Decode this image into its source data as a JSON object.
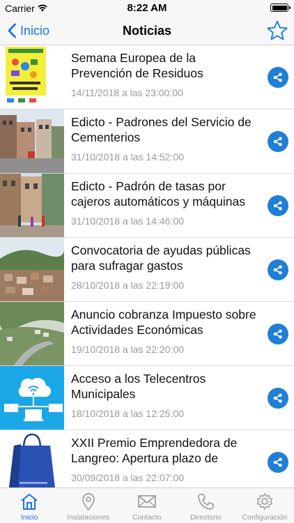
{
  "status_bar": {
    "carrier": "Carrier",
    "time": "8:22 AM"
  },
  "nav": {
    "back_label": "Inicio",
    "title": "Noticias"
  },
  "news": [
    {
      "title": "Semana Europea de la Prevención de Residuos",
      "date": "14/11/2018 a las 23:00:00",
      "thumb": "poster"
    },
    {
      "title": "Edicto - Padrones del Servicio de Cementerios",
      "date": "31/10/2018 a las 14:52:00",
      "thumb": "street"
    },
    {
      "title": "Edicto - Padrón de tasas por cajeros automáticos y máquinas",
      "date": "31/10/2018 a las 14:46:00",
      "thumb": "street2"
    },
    {
      "title": "Convocatoria de ayudas públicas para sufragar gastos",
      "date": "28/10/2018 a las 22:19:00",
      "thumb": "town"
    },
    {
      "title": "Anuncio cobranza Impuesto sobre Actividades Económicas",
      "date": "19/10/2018 a las 22:20:00",
      "thumb": "valley"
    },
    {
      "title": "Acceso a los Telecentros Municipales",
      "date": "18/10/2018 a las 12:25:00",
      "thumb": "network"
    },
    {
      "title": "XXII Premio Emprendedora de Langreo: Apertura plazo de",
      "date": "30/09/2018 a las 22:07:00",
      "thumb": "bag"
    }
  ],
  "tabs": [
    {
      "label": "Inicio",
      "icon": "home-icon",
      "active": true
    },
    {
      "label": "Instalaciones",
      "icon": "location-pin-icon",
      "active": false
    },
    {
      "label": "Contacto",
      "icon": "envelope-icon",
      "active": false
    },
    {
      "label": "Directorio",
      "icon": "phone-icon",
      "active": false
    },
    {
      "label": "Configuración",
      "icon": "gear-icon",
      "active": false
    }
  ],
  "colors": {
    "accent": "#1a73e8",
    "share": "#1f7fd6",
    "date": "#9a9a9a"
  }
}
